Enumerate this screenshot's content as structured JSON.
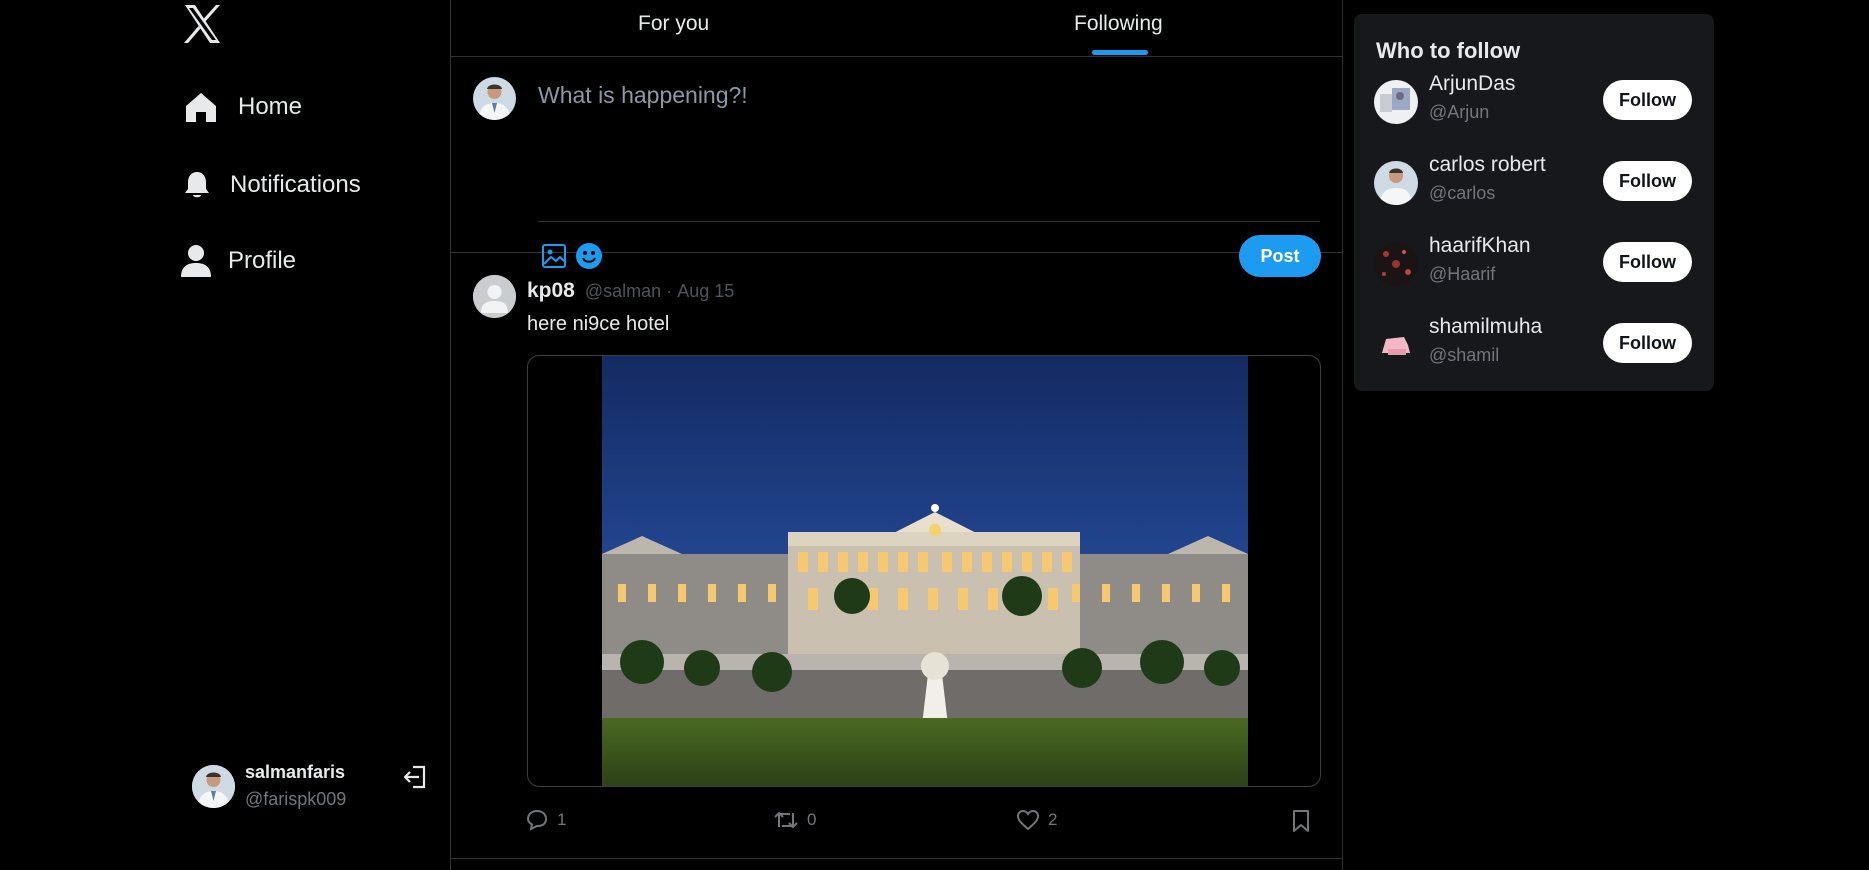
{
  "nav": {
    "items": [
      {
        "label": "Home",
        "icon": "home-icon"
      },
      {
        "label": "Notifications",
        "icon": "bell-icon"
      },
      {
        "label": "Profile",
        "icon": "user-icon"
      }
    ]
  },
  "current_user": {
    "name": "salmanfaris",
    "handle": "@farispk009"
  },
  "tabs": [
    {
      "label": "For you",
      "active": false
    },
    {
      "label": "Following",
      "active": true
    }
  ],
  "composer": {
    "placeholder": "What is happening?!",
    "post_label": "Post"
  },
  "tweet": {
    "name": "kp08",
    "handle": "@salman",
    "separator": "·",
    "date": "Aug 15",
    "text": "here ni9ce hotel",
    "replies": "1",
    "retweets": "0",
    "likes": "2"
  },
  "who_to_follow": {
    "title": "Who to follow",
    "users": [
      {
        "name": "ArjunDas",
        "handle": "@Arjun",
        "button": "Follow"
      },
      {
        "name": "carlos robert",
        "handle": "@carlos",
        "button": "Follow"
      },
      {
        "name": "haarifKhan",
        "handle": "@Haarif",
        "button": "Follow"
      },
      {
        "name": "shamilmuha",
        "handle": "@shamil",
        "button": "Follow"
      }
    ]
  },
  "colors": {
    "accent": "#1d9bf0",
    "background": "#000000",
    "border": "#2f3336",
    "muted": "#71767b"
  }
}
